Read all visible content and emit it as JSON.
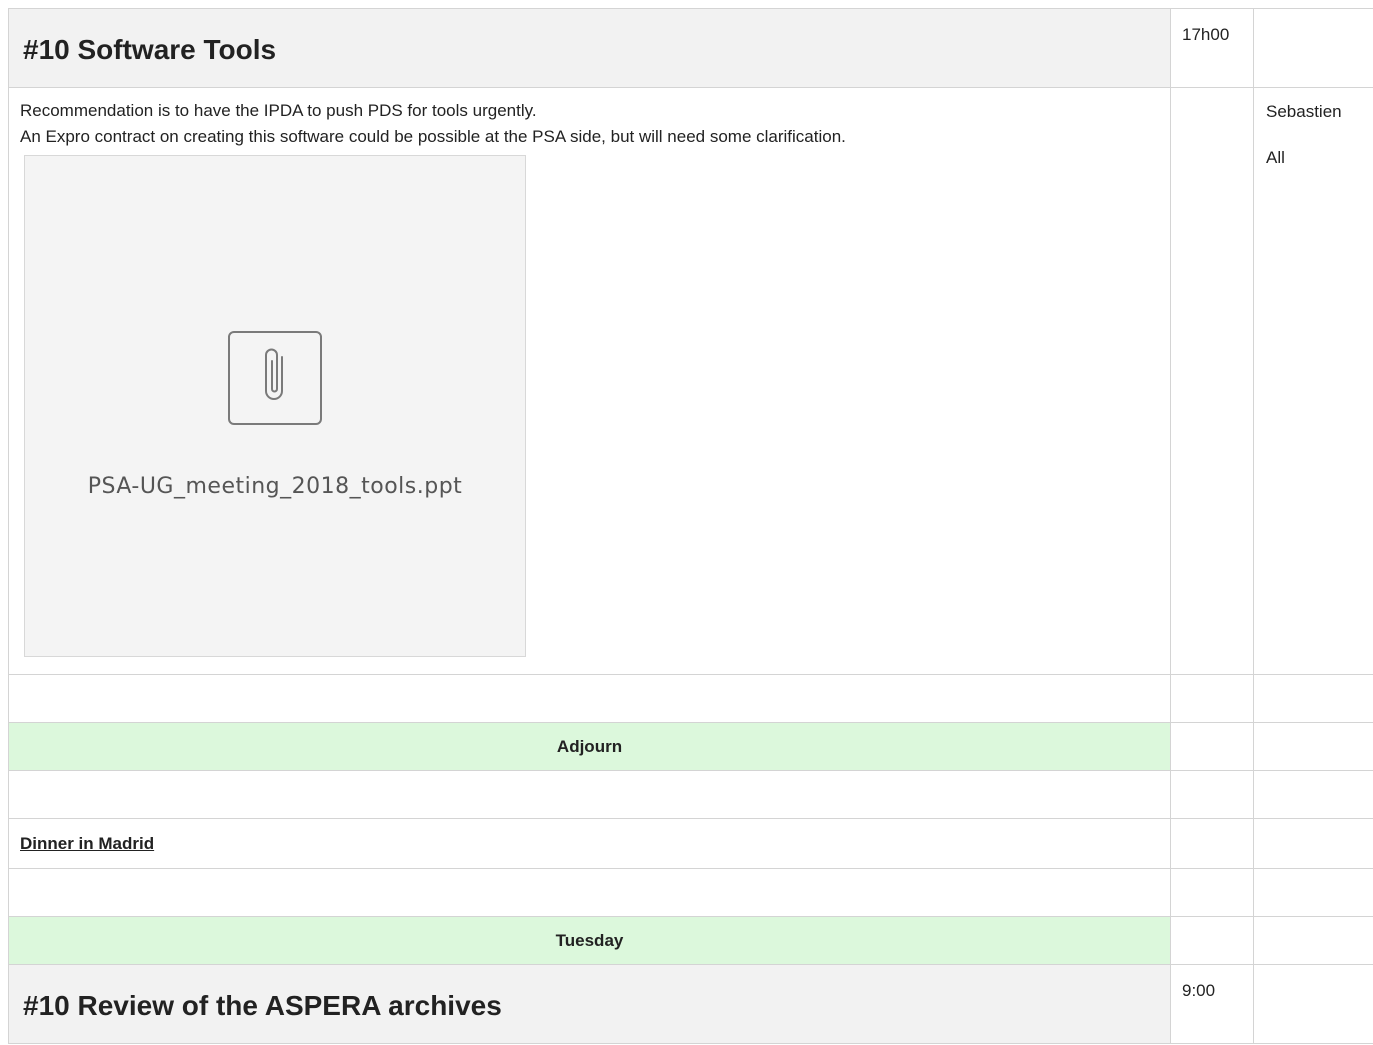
{
  "section1": {
    "title": "#10 Software Tools",
    "time": "17h00",
    "notes": [
      "Recommendation is to have the IPDA to push PDS for tools urgently.",
      "An Expro contract on creating this software could be possible at the PSA side, but will need some clarification."
    ],
    "attachment": {
      "filename": "PSA-UG_meeting_2018_tools.ppt",
      "icon": "paperclip-icon"
    },
    "owners": [
      "Sebastien",
      "All"
    ]
  },
  "adjourn": {
    "label": "Adjourn"
  },
  "dinner": {
    "label": "Dinner in Madrid"
  },
  "tuesday": {
    "label": "Tuesday"
  },
  "section2": {
    "title": "#10 Review of the ASPERA archives",
    "time": "9:00"
  },
  "colors": {
    "heading_bg": "#f2f2f2",
    "band_bg": "#dcf8dc",
    "border": "#d4d4d4"
  }
}
